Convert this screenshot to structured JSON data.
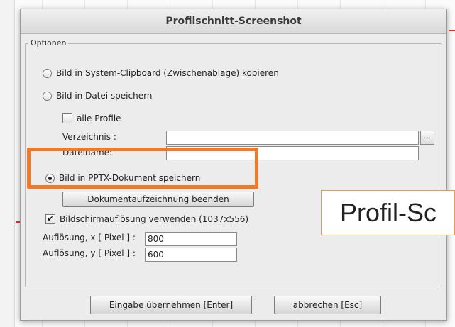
{
  "dialog": {
    "title": "Profilschnitt-Screenshot",
    "group_label": "Optionen",
    "options": {
      "clipboard_label": "Bild in System-Clipboard (Zwischenablage) kopieren",
      "file_label": "Bild in Datei speichern",
      "all_profiles_label": "alle Profile",
      "directory_label": "Verzeichnis :",
      "directory_value": "",
      "filename_label": "Dateiname:",
      "filename_value": "",
      "browse_label": "...",
      "pptx_label": "Bild in PPTX-Dokument speichern",
      "end_recording_label": "Dokumentaufzeichnung beenden",
      "screen_res_label": "Bildschirmauflösung verwenden (1037x556)",
      "res_x_label": "Auflösung, x [ Pixel ] :",
      "res_x_value": "800",
      "res_y_label": "Auflösung, y [ Pixel ] :",
      "res_y_value": "600"
    },
    "buttons": {
      "ok_label": "Eingabe übernehmen [Enter]",
      "cancel_label": "abbrechen [Esc]"
    },
    "state": {
      "selected_option": "pptx",
      "all_profiles_checked": false,
      "screen_res_checked": true
    }
  },
  "callout": {
    "text": "Profil-Sc"
  },
  "colors": {
    "highlight": "#f07a2a",
    "dialog_bg": "#ececec"
  }
}
